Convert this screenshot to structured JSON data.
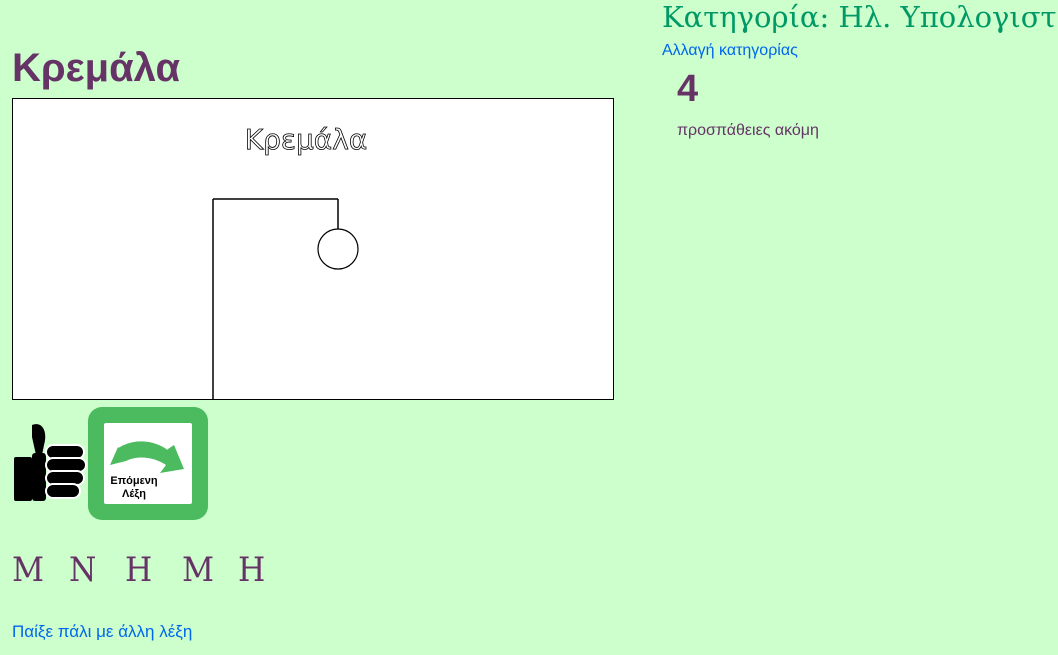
{
  "page": {
    "title": "Κρεμάλα"
  },
  "canvas": {
    "caption": "Κρεμάλα"
  },
  "next_word_button": {
    "label_line1": "Επόμενη",
    "label_line2": "Λέξη"
  },
  "word": {
    "letters": [
      "Μ",
      "Ν",
      "Η",
      "Μ",
      "Η"
    ]
  },
  "links": {
    "play_again": "Παίξε πάλι με άλλη λέξη",
    "change_category": "Αλλαγή κατηγορίας"
  },
  "category": {
    "title": "Κατηγορία: Ηλ. Υπολογιστές"
  },
  "tries": {
    "count": "4",
    "label": "προσπάθειες ακόμη"
  },
  "colors": {
    "background": "#ccffcc",
    "title": "#663366",
    "category": "#009966",
    "link": "#0066ee",
    "next_button": "#4cbb5f"
  },
  "icons": {
    "thumb": "thumbs-up-icon",
    "next_arrow": "curved-arrow-icon"
  }
}
